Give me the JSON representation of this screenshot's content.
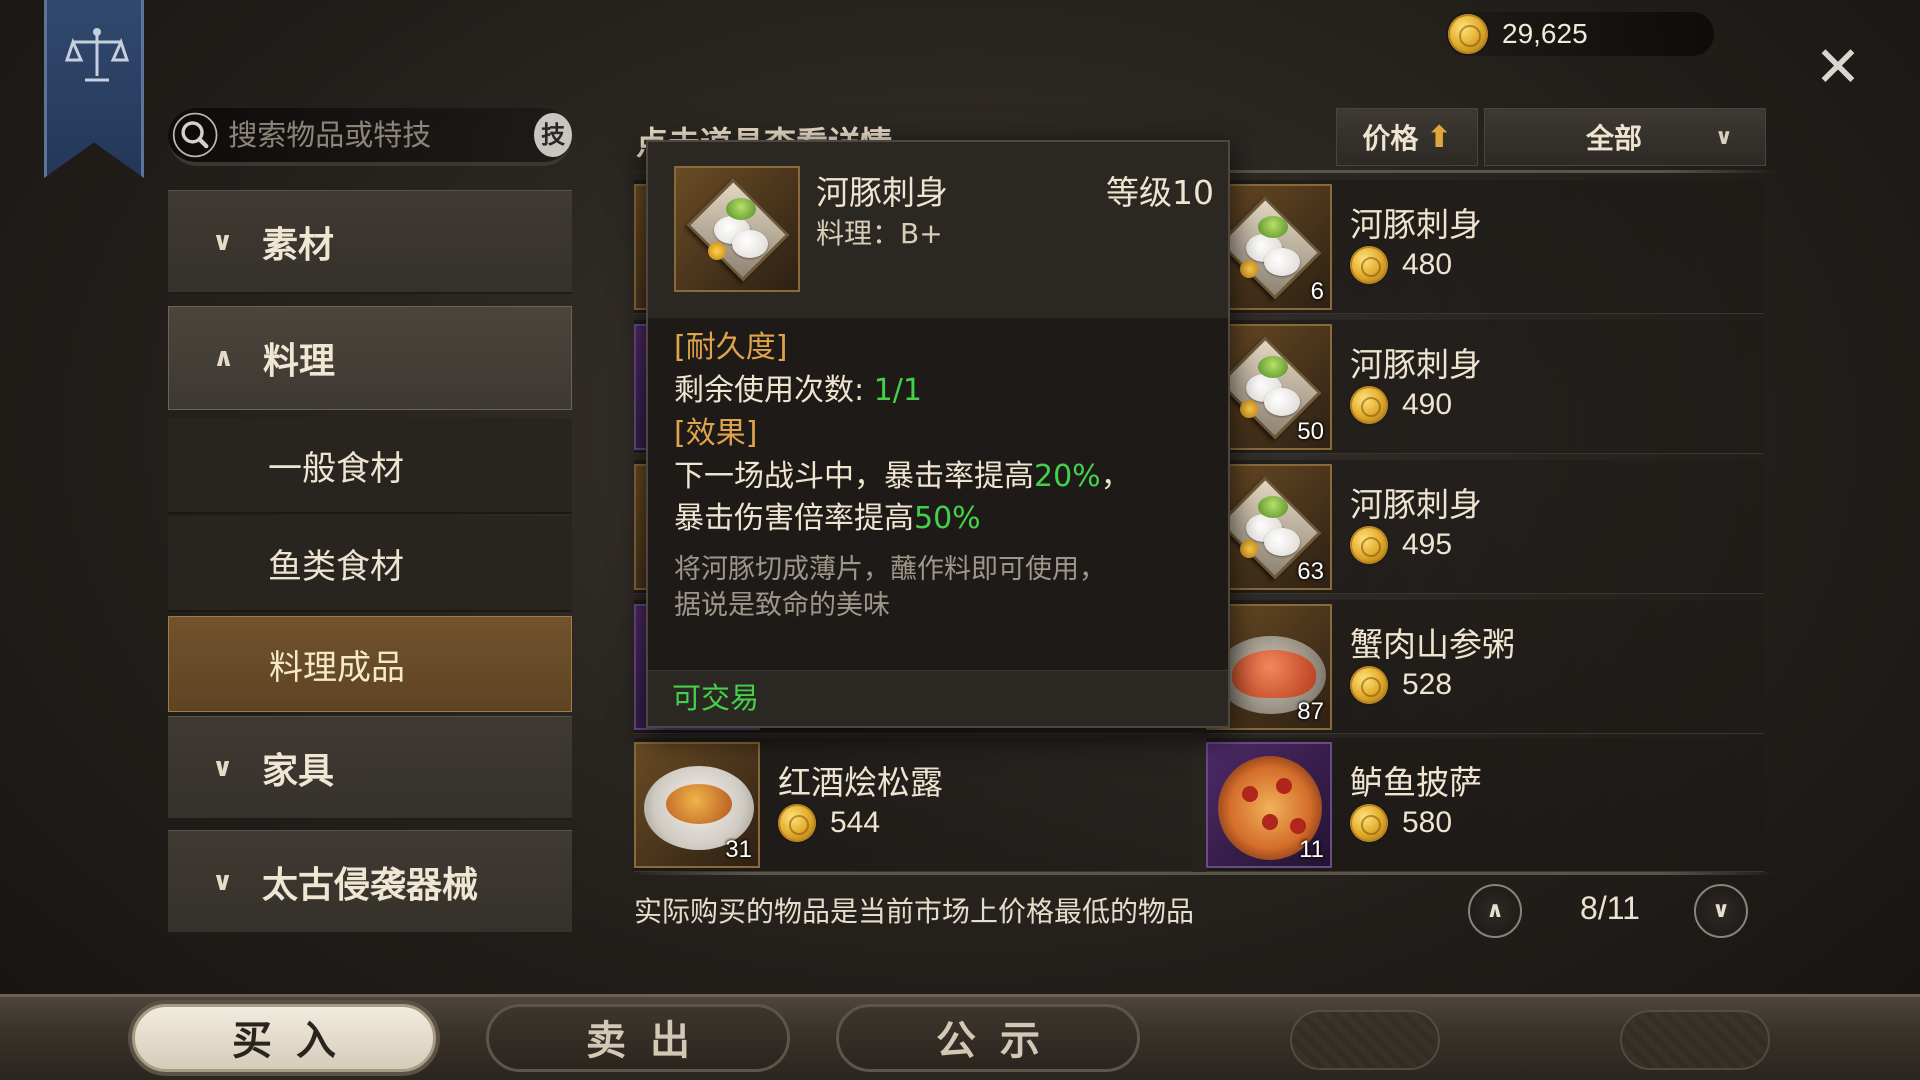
{
  "header": {
    "gold": "29,625",
    "close_label": "✕"
  },
  "search": {
    "placeholder": "搜索物品或特技",
    "skill_label": "技"
  },
  "categories": [
    {
      "label": "素材",
      "state": "collapsed"
    },
    {
      "label": "料理",
      "state": "expanded",
      "children": [
        "一般食材",
        "鱼类食材",
        "料理成品"
      ],
      "active_child": "料理成品"
    },
    {
      "label": "家具",
      "state": "collapsed"
    },
    {
      "label": "太古侵袭器械",
      "state": "collapsed"
    }
  ],
  "section_title": "点击道具查看详情",
  "sort": {
    "label": "价格",
    "direction": "up"
  },
  "filter": {
    "value": "全部"
  },
  "items_right": [
    {
      "name": "河豚刺身",
      "price": "480",
      "qty": "6",
      "frame": "gold"
    },
    {
      "name": "河豚刺身",
      "price": "490",
      "qty": "50",
      "frame": "gold"
    },
    {
      "name": "河豚刺身",
      "price": "495",
      "qty": "63",
      "frame": "gold"
    },
    {
      "name": "蟹肉山参粥",
      "price": "528",
      "qty": "87",
      "frame": "gold"
    },
    {
      "name": "鲈鱼披萨",
      "price": "580",
      "qty": "11",
      "frame": "purple"
    }
  ],
  "items_left": [
    {
      "name": "红酒烩松露",
      "price": "544",
      "qty": "31",
      "frame": "gold"
    }
  ],
  "tooltip": {
    "name": "河豚刺身",
    "level": "等级10",
    "grade": "料理：B+",
    "durability_header": "[耐久度]",
    "uses_label": "剩余使用次数: ",
    "uses_value": "1/1",
    "effect_header": "[效果]",
    "effect_1a": "下一场战斗中，暴击率提高",
    "effect_1b": "20%",
    "effect_1c": "，",
    "effect_2a": "暴击伤害倍率提高",
    "effect_2b": "50%",
    "description_1": "将河豚切成薄片，蘸作料即可使用，",
    "description_2": "据说是致命的美味",
    "tradable": "可交易"
  },
  "notice": "实际购买的物品是当前市场上价格最低的物品",
  "pagination": {
    "current": "8",
    "total": "11",
    "text": "8/11"
  },
  "tabs": [
    {
      "label": "买入",
      "active": true
    },
    {
      "label": "卖出",
      "active": false
    },
    {
      "label": "公示",
      "active": false
    }
  ],
  "colors": {
    "accent_green": "#44d14a",
    "section_orange": "#e0a24a",
    "active_category": "#71532c",
    "banner_blue": "#31496f"
  },
  "icons": [
    "scales-icon",
    "coin-icon",
    "close-icon",
    "search-icon",
    "chevron-down-icon",
    "chevron-up-icon",
    "arrow-up-icon"
  ]
}
